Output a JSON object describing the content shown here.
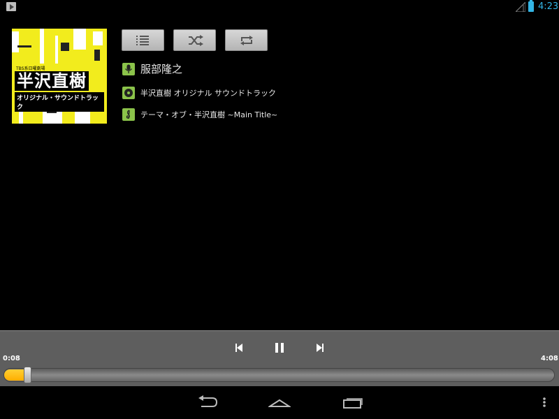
{
  "status_bar": {
    "time": "4:23",
    "notification_icon": "play-notification-icon",
    "signal_icon": "signal-icon",
    "battery_icon": "battery-icon",
    "accent_color": "#33b5e5"
  },
  "album": {
    "art_small_text": "TBS系日曜劇場",
    "art_title": "半沢直樹",
    "art_subtitle": "オリジナル・サウンドトラック",
    "art_color": "#f2ec1d"
  },
  "buttons": {
    "playlist_icon": "playlist-icon",
    "shuffle_icon": "shuffle-icon",
    "repeat_icon": "repeat-icon"
  },
  "track_info": {
    "artist": "服部隆之",
    "album": "半沢直樹 オリジナル サウンドトラック",
    "title": "テーマ・オブ・半沢直樹 ~Main Title~",
    "icon_color": "#8bc34a"
  },
  "player": {
    "elapsed": "0:08",
    "duration": "4:08",
    "progress_fraction": 0.032,
    "progress_color": "#ffb800"
  },
  "nav_bar": {
    "back_icon": "back-icon",
    "home_icon": "home-icon",
    "recents_icon": "recent-apps-icon",
    "menu_icon": "overflow-menu-icon"
  }
}
